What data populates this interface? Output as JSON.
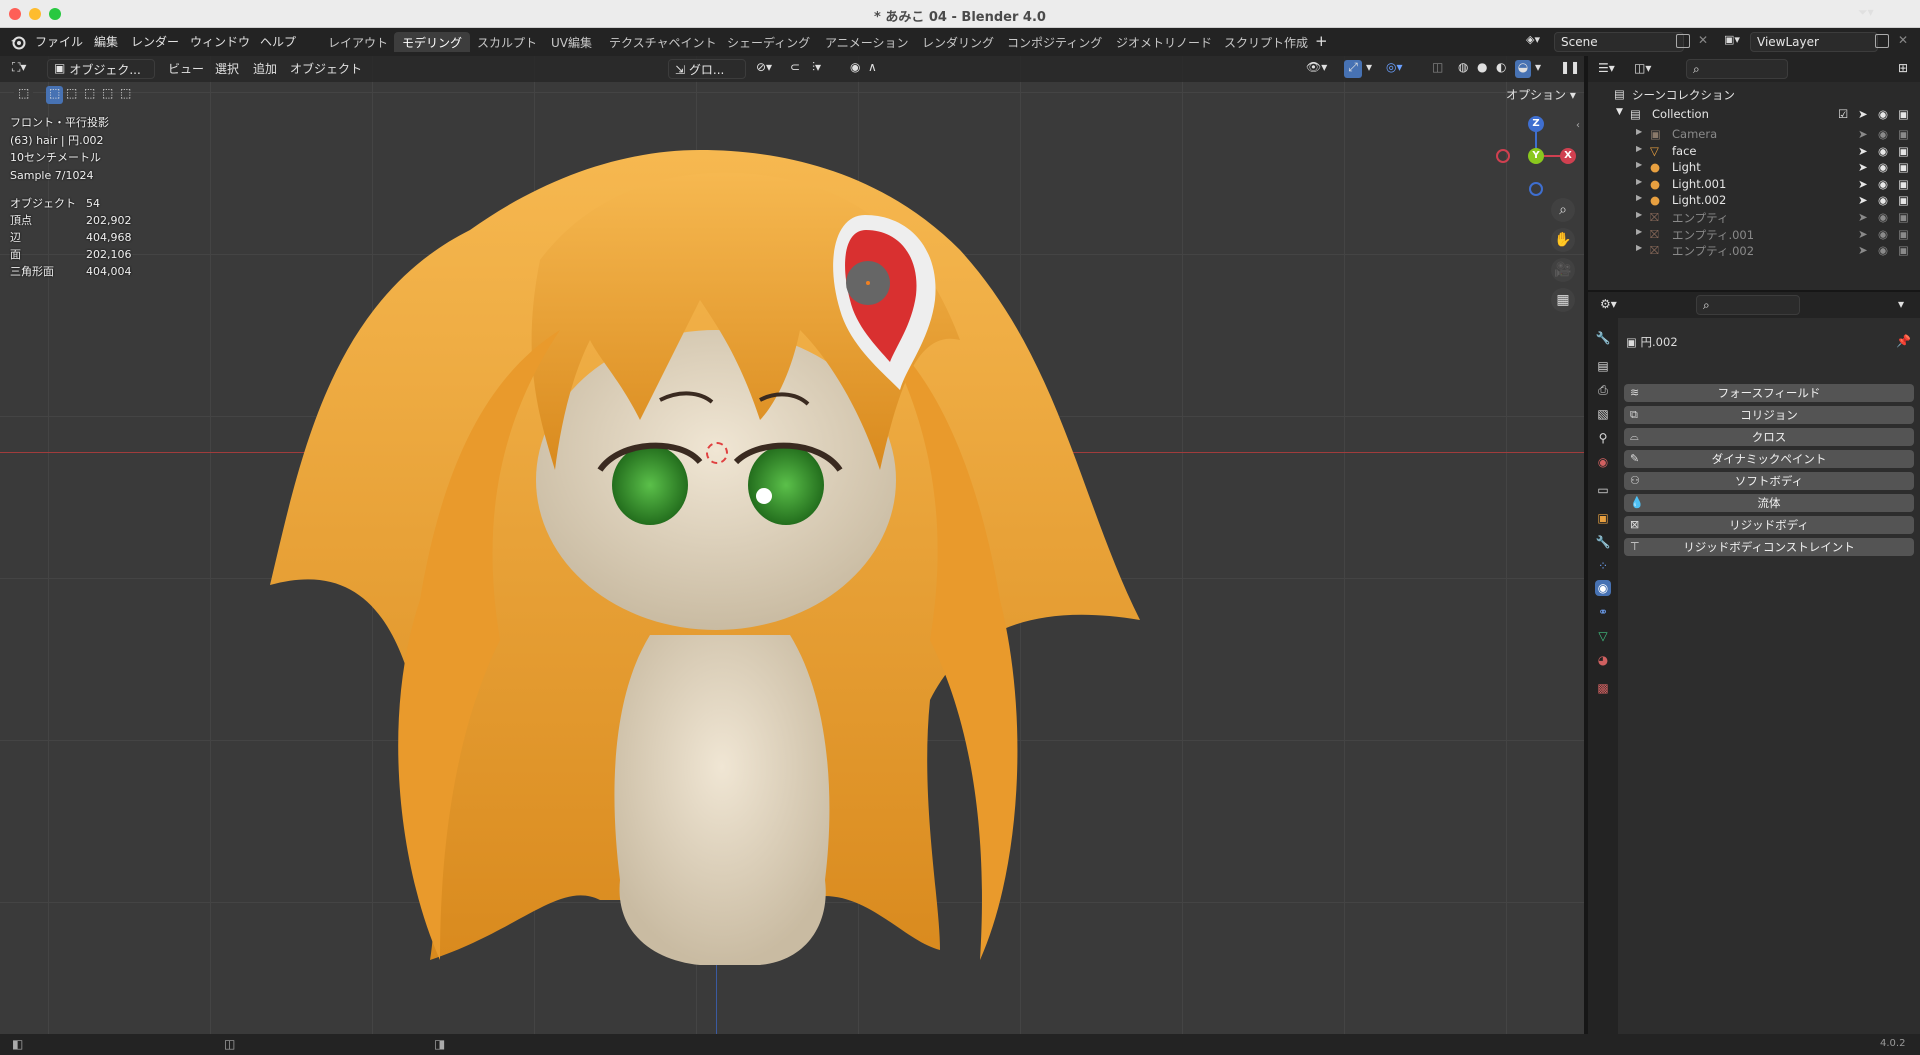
{
  "window": {
    "title": "* あみこ 04 - Blender 4.0"
  },
  "menu": [
    "ファイル",
    "編集",
    "レンダー",
    "ウィンドウ",
    "ヘルプ"
  ],
  "workspaces": [
    "レイアウト",
    "モデリング",
    "スカルプト",
    "UV編集",
    "テクスチャペイント",
    "シェーディング",
    "アニメーション",
    "レンダリング",
    "コンポジティング",
    "ジオメトリノード",
    "スクリプト作成"
  ],
  "active_workspace": "モデリング",
  "scene": {
    "name": "Scene",
    "view_layer": "ViewLayer"
  },
  "viewport_header": {
    "mode": "オブジェク...",
    "menus": [
      "ビュー",
      "選択",
      "追加",
      "オブジェクト"
    ],
    "transform_orientation": "グロ...",
    "options": "オプション"
  },
  "viewport_info": {
    "view": "フロント・平行投影",
    "object": "(63) hair | 円.002",
    "scale": "10センチメートル",
    "sample": "Sample 7/1024"
  },
  "stats": [
    {
      "label": "オブジェクト",
      "value": "54"
    },
    {
      "label": "頂点",
      "value": "202,902"
    },
    {
      "label": "辺",
      "value": "404,968"
    },
    {
      "label": "面",
      "value": "202,106"
    },
    {
      "label": "三角形面",
      "value": "404,004"
    }
  ],
  "gizmo": {
    "z": "Z",
    "y": "Y",
    "x": "X"
  },
  "outliner": {
    "root": "シーンコレクション",
    "collection": "Collection",
    "items": [
      {
        "name": "Camera",
        "icon": "camera-icon",
        "dim": true
      },
      {
        "name": "face",
        "icon": "mesh-icon",
        "dim": false
      },
      {
        "name": "Light",
        "icon": "light-icon",
        "dim": false
      },
      {
        "name": "Light.001",
        "icon": "light-icon",
        "dim": false
      },
      {
        "name": "Light.002",
        "icon": "light-icon",
        "dim": false
      },
      {
        "name": "エンプティ",
        "icon": "empty-icon",
        "dim": true
      },
      {
        "name": "エンプティ.001",
        "icon": "empty-icon",
        "dim": true
      },
      {
        "name": "エンプティ.002",
        "icon": "empty-icon",
        "dim": true
      }
    ]
  },
  "properties": {
    "object_name": "円.002",
    "physics_buttons": [
      "フォースフィールド",
      "コリジョン",
      "クロス",
      "ダイナミックペイント",
      "ソフトボディ",
      "流体",
      "リジッドボディ",
      "リジッドボディコンストレイント"
    ]
  },
  "version": "4.0.2",
  "colors": {
    "accent": "#4772b3",
    "hair": "#f0a030",
    "skin": "#e8dcc8",
    "eyes": "#3a9a30",
    "pin_red": "#d93030"
  }
}
